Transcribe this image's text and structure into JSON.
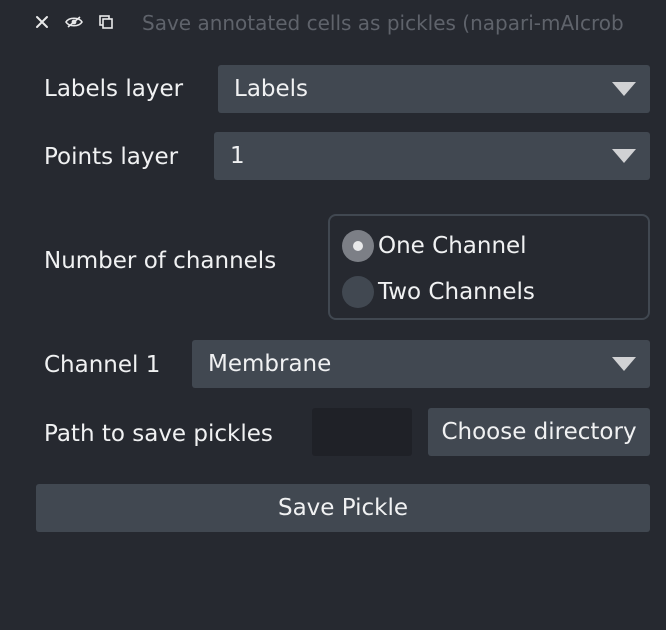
{
  "window": {
    "title": "Save annotated cells as pickles (napari-mAIcrob",
    "icons": [
      "close-icon",
      "hide-icon",
      "float-icon"
    ]
  },
  "form": {
    "labels_layer": {
      "label": "Labels layer",
      "value": "Labels"
    },
    "points_layer": {
      "label": "Points layer",
      "value": "1"
    },
    "num_channels": {
      "label": "Number of channels",
      "options": [
        "One Channel",
        "Two Channels"
      ],
      "selected": "One Channel"
    },
    "channel1": {
      "label": "Channel 1",
      "value": "Membrane"
    },
    "path": {
      "label": "Path to save pickles",
      "value": "",
      "button": "Choose directory"
    },
    "save_button": "Save Pickle"
  },
  "colors": {
    "background": "#262930",
    "control": "#414851",
    "input_dark": "#1f2127",
    "text": "#f0f1f2",
    "title_text": "#5f636b"
  }
}
